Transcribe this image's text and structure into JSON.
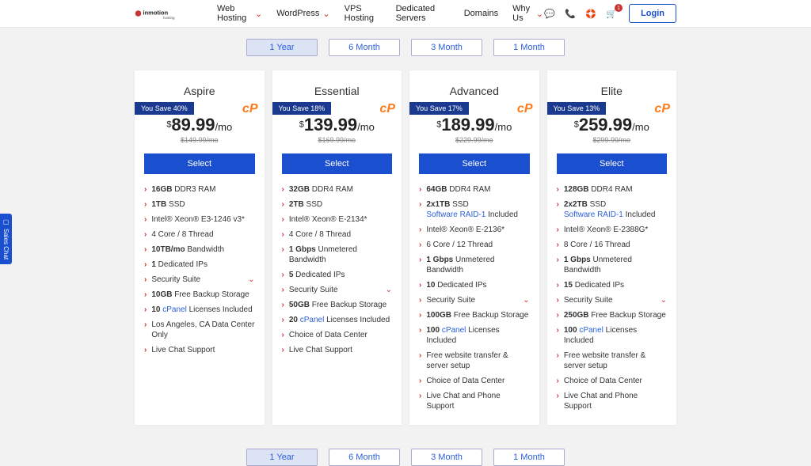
{
  "header": {
    "brand": "inmotion hosting",
    "nav": [
      "Web Hosting",
      "WordPress",
      "VPS Hosting",
      "Dedicated Servers",
      "Domains",
      "Why Us"
    ],
    "nav_has_chev": [
      true,
      true,
      false,
      false,
      false,
      true
    ],
    "icons": [
      "chat-icon",
      "phone-icon",
      "support-icon",
      "cart-icon"
    ],
    "cart_count": "1",
    "login": "Login"
  },
  "terms": [
    "1 Year",
    "6 Month",
    "3 Month",
    "1 Month"
  ],
  "active_term": 0,
  "sales_chat": "Sales Chat",
  "plans": [
    {
      "name": "Aspire",
      "save": "You Save 40%",
      "price": "89.99",
      "per": "/mo",
      "strike": "$149.99/mo",
      "select": "Select",
      "features": [
        "<b>16GB</b> DDR3 RAM",
        "<b>1TB</b> SSD",
        "Intel® Xeon® E3-1246 v3*",
        "4 Core / 8 Thread",
        "<b>10TB/mo</b> Bandwidth",
        "<b>1</b> Dedicated IPs",
        "SUITE",
        "<b>10GB</b> Free Backup Storage",
        "<b>10</b> <span class='lk'>cPanel</span> Licenses Included",
        "Los Angeles, CA Data Center Only",
        "Live Chat Support"
      ]
    },
    {
      "name": "Essential",
      "save": "You Save 18%",
      "price": "139.99",
      "per": "/mo",
      "strike": "$169.99/mo",
      "select": "Select",
      "features": [
        "<b>32GB</b> DDR4 RAM",
        "<b>2TB</b> SSD",
        "Intel® Xeon® E-2134*",
        "4 Core / 8 Thread",
        "<b>1 Gbps</b> Unmetered Bandwidth",
        "<b>5</b> Dedicated IPs",
        "SUITE",
        "<b>50GB</b> Free Backup Storage",
        "<b>20</b> <span class='lk'>cPanel</span> Licenses Included",
        "Choice of Data Center",
        "Live Chat Support"
      ]
    },
    {
      "name": "Advanced",
      "save": "You Save 17%",
      "price": "189.99",
      "per": "/mo",
      "strike": "$229.99/mo",
      "select": "Select",
      "features": [
        "<b>64GB</b> DDR4 RAM",
        "<b>2x1TB</b> SSD<br><span class='lk'>Software RAID-1</span> Included",
        "Intel® Xeon® E-2136*",
        "6 Core / 12 Thread",
        "<b>1 Gbps</b> Unmetered Bandwidth",
        "<b>10</b> Dedicated IPs",
        "SUITE",
        "<b>100GB</b> Free Backup Storage",
        "<b>100</b> <span class='lk'>cPanel</span> Licenses Included",
        "Free website transfer & server setup",
        "Choice of Data Center",
        "Live Chat and Phone Support"
      ]
    },
    {
      "name": "Elite",
      "save": "You Save 13%",
      "price": "259.99",
      "per": "/mo",
      "strike": "$299.99/mo",
      "select": "Select",
      "features": [
        "<b>128GB</b> DDR4 RAM",
        "<b>2x2TB</b> SSD<br><span class='lk'>Software RAID-1</span> Included",
        "Intel® Xeon® E-2388G*",
        "8 Core / 16 Thread",
        "<b>1 Gbps</b> Unmetered Bandwidth",
        "<b>15</b> Dedicated IPs",
        "SUITE",
        "<b>250GB</b> Free Backup Storage",
        "<b>100</b> <span class='lk'>cPanel</span> Licenses Included",
        "Free website transfer & server setup",
        "Choice of Data Center",
        "Live Chat and Phone Support"
      ]
    }
  ],
  "security_suite": "Security Suite"
}
